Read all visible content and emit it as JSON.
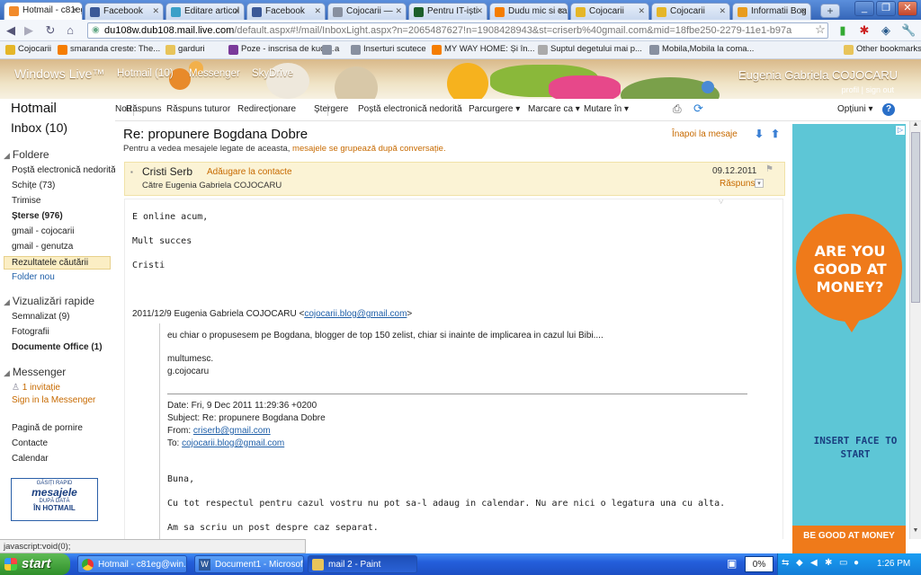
{
  "browser": {
    "tabs": [
      {
        "label": "Hotmail - c81eg",
        "active": true,
        "color": "#f28b2b"
      },
      {
        "label": "Facebook",
        "color": "#3b5998"
      },
      {
        "label": "Editare articol",
        "color": "#3aa0c8"
      },
      {
        "label": "Facebook",
        "color": "#3b5998"
      },
      {
        "label": "Cojocarii —",
        "color": "#8890a0"
      },
      {
        "label": "Pentru IT-iști",
        "color": "#1c5e2a"
      },
      {
        "label": "Dudu mic si ca",
        "color": "#f57d00"
      },
      {
        "label": "Cojocarii",
        "color": "#e5b628"
      },
      {
        "label": "Cojocarii",
        "color": "#e5b628"
      },
      {
        "label": "Informatii Bog",
        "color": "#e89c1e"
      }
    ],
    "url_host": "du108w.dub108.mail.live.com",
    "url_rest": "/default.aspx#!/mail/InboxLight.aspx?n=2065487627!n=1908428943&st=criserb%40gmail.com&mid=18fbe250-2279-11e1-b97a",
    "bookmarks": [
      {
        "label": "Cojocarii",
        "color": "#e5b628"
      },
      {
        "label": "smaranda creste: The...",
        "color": "#f57d00"
      },
      {
        "label": "garduri",
        "color": "#e8c45a"
      },
      {
        "label": "Poze - inscrisa de kudi...",
        "color": "#7a3a9a"
      },
      {
        "label": "a",
        "color": "#8890a0"
      },
      {
        "label": "Inserturi scutece",
        "color": "#8890a0"
      },
      {
        "label": "MY WAY HOME: Și în...",
        "color": "#f57d00"
      },
      {
        "label": "Suptul degetului mai p...",
        "color": "#aaaaaa"
      },
      {
        "label": "Mobila,Mobila la coma...",
        "color": "#8890a0"
      }
    ],
    "other_bookmarks": "Other bookmarks"
  },
  "header": {
    "logo": "Windows Live™",
    "nav": [
      "Hotmail (10)",
      "Messenger",
      "SkyDrive"
    ],
    "user_name": "Eugenia Gabriela COJOCARU",
    "profile": "profil",
    "signout": "sign out"
  },
  "sidebar": {
    "title": "Hotmail",
    "inbox": "Inbox (10)",
    "folders_heading": "Foldere",
    "folders": [
      {
        "label": "Poștă electronică nedorită"
      },
      {
        "label": "Schițe (73)"
      },
      {
        "label": "Trimise"
      },
      {
        "label": "Șterse (976)",
        "bold": true
      },
      {
        "label": "gmail - cojocarii"
      },
      {
        "label": "gmail - genutza"
      },
      {
        "label": "Rezultatele căutării",
        "selected": true
      },
      {
        "label": "Folder nou",
        "link": true
      }
    ],
    "quick_heading": "Vizualizări rapide",
    "quick": [
      {
        "label": "Semnalizat (9)"
      },
      {
        "label": "Fotografii"
      },
      {
        "label": "Documente Office (1)",
        "bold": true
      }
    ],
    "messenger_heading": "Messenger",
    "invitation": "1 invitație",
    "signin": "Sign in la Messenger",
    "bottom_links": [
      "Pagină de pornire",
      "Contacte",
      "Calendar"
    ],
    "promo": {
      "line1": "GĂSIȚI RAPID",
      "line2": "mesajele",
      "line3": "DUPĂ DATĂ",
      "line4": "ÎN HOTMAIL"
    }
  },
  "toolbar": {
    "items": [
      "Nou",
      "Răspuns",
      "Răspuns tuturor",
      "Redirecționare",
      "Ștergere",
      "Poștă electronică nedorită",
      "Parcurgere ▾",
      "Marcare ca ▾",
      "Mutare în ▾"
    ],
    "options": "Opțiuni ▾",
    "help": "?"
  },
  "message": {
    "subject": "Re: propunere Bogdana Dobre",
    "conv_note": "Pentru a vedea mesajele legate de aceasta,",
    "conv_link": "mesajele se grupează după conversație.",
    "back": "Înapoi la mesaje",
    "sender": "Cristi Serb",
    "add_contact": "Adăugare la contacte",
    "to": "Către Eugenia Gabriela COJOCARU",
    "date": "09.12.2011",
    "reply": "Răspuns",
    "lines": [
      "E online acum,",
      "Mult succes",
      "Cristi"
    ],
    "quote_header": "2011/12/9 Eugenia Gabriela COJOCARU <",
    "quote_email": "cojocarii.blog@gmail.com",
    "quote_header_end": ">",
    "quote": [
      "eu chiar o propusesem pe Bogdana, blogger de top 150 zelist, chiar si inainte de implicarea in cazul lui Bibi....",
      "multumesc.",
      "g.cojocaru"
    ],
    "fwd": {
      "date": "Date: Fri, 9 Dec 2011 11:29:36 +0200",
      "subject": "Subject: Re: propunere Bogdana Dobre",
      "from_label": "From: ",
      "from": "criserb@gmail.com",
      "to_label": "To: ",
      "to": "cojocarii.blog@gmail.com"
    },
    "tail": [
      "Buna,",
      "Cu tot respectul pentru cazul vostru nu pot sa-l adaug in calendar. Nu are nici o legatura una cu alta.",
      "Am sa scriu un post despre caz separat."
    ]
  },
  "ad": {
    "bubble": "ARE YOU GOOD AT MONEY?",
    "insert": "INSERT FACE TO START",
    "footer": "BE GOOD AT MONEY"
  },
  "status": "javascript:void(0);",
  "taskbar": {
    "start": "start",
    "tasks": [
      "Hotmail - c81eg@win...",
      "Document1 - Microsof...",
      "mail 2 - Paint"
    ],
    "percent": "0%",
    "clock": "1:26 PM"
  }
}
